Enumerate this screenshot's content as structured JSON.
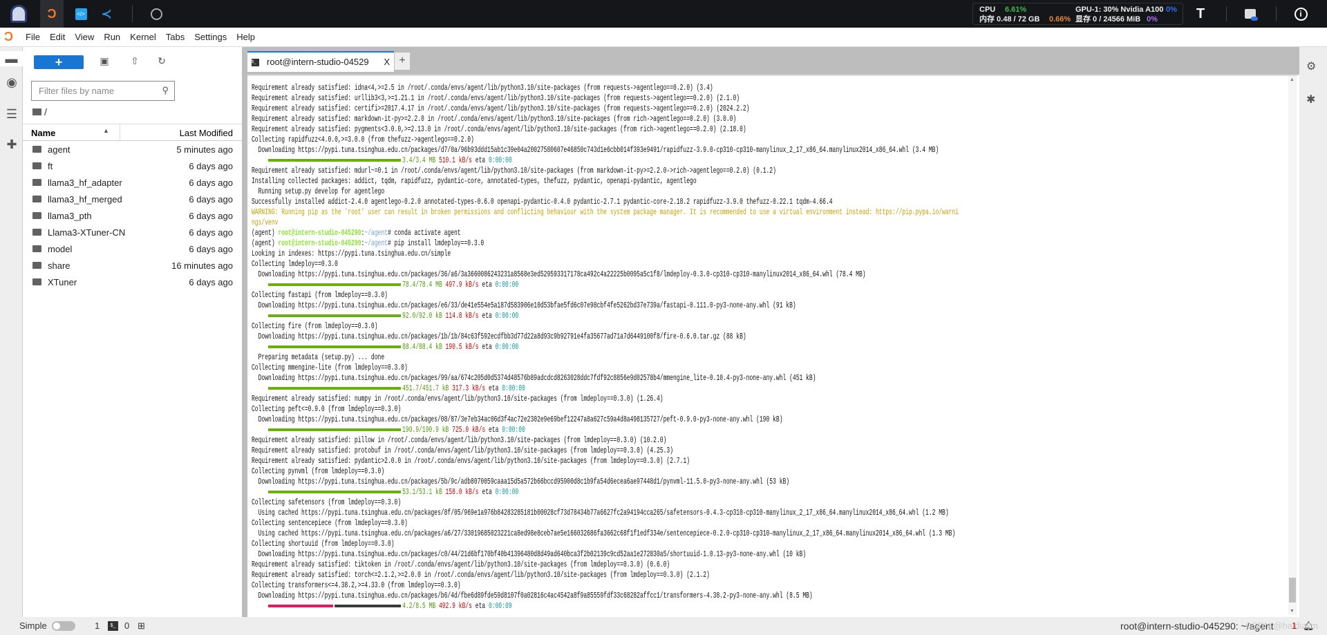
{
  "topbar": {
    "icons": [
      "avatar-logo",
      "jupyter-icon",
      "code-icon",
      "vscode-icon",
      "compass-icon"
    ],
    "cpu_label": "CPU",
    "cpu_value": "6.61%",
    "mem_label": "内存 0.48 / 72 GB",
    "mem_value": "0.66%",
    "gpu_label": "GPU-1: 30% Nvidia A100",
    "gpu_value": "0%",
    "vram_label": "显存 0 / 24566 MiB",
    "vram_value": "0%",
    "colors": {
      "cpu": "#3fb950",
      "mem": "#e3893b",
      "gpu": "#2f6feb",
      "vram": "#a371f7"
    }
  },
  "menu": [
    "File",
    "Edit",
    "View",
    "Run",
    "Kernel",
    "Tabs",
    "Settings",
    "Help"
  ],
  "files": {
    "filter_placeholder": "Filter files by name",
    "breadcrumb": "/",
    "col_name": "Name",
    "col_modified": "Last Modified",
    "rows": [
      {
        "name": "agent",
        "modified": "5 minutes ago"
      },
      {
        "name": "ft",
        "modified": "6 days ago"
      },
      {
        "name": "llama3_hf_adapter",
        "modified": "6 days ago"
      },
      {
        "name": "llama3_hf_merged",
        "modified": "6 days ago"
      },
      {
        "name": "llama3_pth",
        "modified": "6 days ago"
      },
      {
        "name": "Llama3-XTuner-CN",
        "modified": "6 days ago"
      },
      {
        "name": "model",
        "modified": "6 days ago"
      },
      {
        "name": "share",
        "modified": "16 minutes ago"
      },
      {
        "name": "XTuner",
        "modified": "6 days ago"
      }
    ]
  },
  "tab": {
    "title": "root@intern-studio-04529",
    "close": "X",
    "add": "+"
  },
  "terminal": {
    "lines": [
      {
        "t": "text",
        "s": "Requirement already satisfied: idna<4,>=2.5 in /root/.conda/envs/agent/lib/python3.10/site-packages (from requests->agentlego==0.2.0) (3.4)"
      },
      {
        "t": "text",
        "s": "Requirement already satisfied: urllib3<3,>=1.21.1 in /root/.conda/envs/agent/lib/python3.10/site-packages (from requests->agentlego==0.2.0) (2.1.0)"
      },
      {
        "t": "text",
        "s": "Requirement already satisfied: certifi>=2017.4.17 in /root/.conda/envs/agent/lib/python3.10/site-packages (from requests->agentlego==0.2.0) (2024.2.2)"
      },
      {
        "t": "text",
        "s": "Requirement already satisfied: markdown-it-py>=2.2.0 in /root/.conda/envs/agent/lib/python3.10/site-packages (from rich->agentlego==0.2.0) (3.0.0)"
      },
      {
        "t": "text",
        "s": "Requirement already satisfied: pygments<3.0.0,>=2.13.0 in /root/.conda/envs/agent/lib/python3.10/site-packages (from rich->agentlego==0.2.0) (2.18.0)"
      },
      {
        "t": "text",
        "s": "Collecting rapidfuzz<4.0.0,>=3.0.0 (from thefuzz->agentlego==0.2.0)"
      },
      {
        "t": "text",
        "s": "  Downloading https://pypi.tuna.tsinghua.edu.cn/packages/d7/0a/96b93ddd15ab1c39e04a20027580607e46850c743d1e6cbb014f393e9491/rapidfuzz-3.9.0-cp310-cp310-manylinux_2_17_x86_64.manylinux2014_x86_64.whl (3.4 MB)"
      },
      {
        "t": "progress",
        "fraction": 1.0,
        "size": "3.4/3.4 MB",
        "rate": "510.1 kB/s",
        "eta_label": "eta",
        "eta": "0:00:00"
      },
      {
        "t": "text",
        "s": "Requirement already satisfied: mdurl~=0.1 in /root/.conda/envs/agent/lib/python3.10/site-packages (from markdown-it-py>=2.2.0->rich->agentlego==0.2.0) (0.1.2)"
      },
      {
        "t": "text",
        "s": "Installing collected packages: addict, tqdm, rapidfuzz, pydantic-core, annotated-types, thefuzz, pydantic, openapi-pydantic, agentlego"
      },
      {
        "t": "text",
        "s": "  Running setup.py develop for agentlego"
      },
      {
        "t": "text",
        "s": "Successfully installed addict-2.4.0 agentlego-0.2.0 annotated-types-0.6.0 openapi-pydantic-0.4.0 pydantic-2.7.1 pydantic-core-2.18.2 rapidfuzz-3.9.0 thefuzz-0.22.1 tqdm-4.66.4"
      },
      {
        "t": "warn",
        "s": "WARNING: Running pip as the 'root' user can result in broken permissions and conflicting behaviour with the system package manager. It is recommended to use a virtual environment instead: https://pip.pypa.io/warni"
      },
      {
        "t": "warn",
        "s": "ngs/venv"
      },
      {
        "t": "prompt",
        "env": "(agent) ",
        "user": "root@intern-studio-045290",
        "sep": ":",
        "path": "~/agent",
        "cmd": "# conda activate agent"
      },
      {
        "t": "prompt",
        "env": "(agent) ",
        "user": "root@intern-studio-045290",
        "sep": ":",
        "path": "~/agent",
        "cmd": "# pip install lmdeploy==0.3.0"
      },
      {
        "t": "text",
        "s": "Looking in indexes: https://pypi.tuna.tsinghua.edu.cn/simple"
      },
      {
        "t": "text",
        "s": "Collecting lmdeploy==0.3.0"
      },
      {
        "t": "text",
        "s": "  Downloading https://pypi.tuna.tsinghua.edu.cn/packages/36/a6/3a3660086243231a8568e3ed529593317178ca492c4a22225b0095a5c1f8/lmdeploy-0.3.0-cp310-cp310-manylinux2014_x86_64.whl (78.4 MB)"
      },
      {
        "t": "progress",
        "fraction": 1.0,
        "size": "78.4/78.4 MB",
        "rate": "497.9 kB/s",
        "eta_label": "eta",
        "eta": "0:00:00"
      },
      {
        "t": "text",
        "s": "Collecting fastapi (from lmdeploy==0.3.0)"
      },
      {
        "t": "text",
        "s": "  Downloading https://pypi.tuna.tsinghua.edu.cn/packages/e6/33/de41e554e5a187d583906e10d53bfae5fd6c07e98cbf4fe5262bd37e739a/fastapi-0.111.0-py3-none-any.whl (91 kB)"
      },
      {
        "t": "progress",
        "fraction": 1.0,
        "size": "92.0/92.0 kB",
        "rate": "114.8 kB/s",
        "eta_label": "eta",
        "eta": "0:00:00"
      },
      {
        "t": "text",
        "s": "Collecting fire (from lmdeploy==0.3.0)"
      },
      {
        "t": "text",
        "s": "  Downloading https://pypi.tuna.tsinghua.edu.cn/packages/1b/1b/84c63f592ecdfbb3d77d22a8d93c9b92791e4fa35677ad71a7d6449100f8/fire-0.6.0.tar.gz (88 kB)"
      },
      {
        "t": "progress",
        "fraction": 1.0,
        "size": "88.4/88.4 kB",
        "rate": "190.5 kB/s",
        "eta_label": "eta",
        "eta": "0:00:00"
      },
      {
        "t": "text",
        "s": "  Preparing metadata (setup.py) ... done"
      },
      {
        "t": "text",
        "s": "Collecting mmengine-lite (from lmdeploy==0.3.0)"
      },
      {
        "t": "text",
        "s": "  Downloading https://pypi.tuna.tsinghua.edu.cn/packages/99/aa/674c205d0d5374d48576b89adcdcd8263028ddc7fdf92c8856e9d02578b4/mmengine_lite-0.10.4-py3-none-any.whl (451 kB)"
      },
      {
        "t": "progress",
        "fraction": 1.0,
        "size": "451.7/451.7 kB",
        "rate": "317.3 kB/s",
        "eta_label": "eta",
        "eta": "0:00:00"
      },
      {
        "t": "text",
        "s": "Requirement already satisfied: numpy in /root/.conda/envs/agent/lib/python3.10/site-packages (from lmdeploy==0.3.0) (1.26.4)"
      },
      {
        "t": "text",
        "s": "Collecting peft<=0.9.0 (from lmdeploy==0.3.0)"
      },
      {
        "t": "text",
        "s": "  Downloading https://pypi.tuna.tsinghua.edu.cn/packages/08/87/3e7eb34ac06d3f4ac72e2302e9e69bef12247a8a627c59a4d8a498135727/peft-0.9.0-py3-none-any.whl (190 kB)"
      },
      {
        "t": "progress",
        "fraction": 1.0,
        "size": "190.9/190.9 kB",
        "rate": "725.0 kB/s",
        "eta_label": "eta",
        "eta": "0:00:00"
      },
      {
        "t": "text",
        "s": "Requirement already satisfied: pillow in /root/.conda/envs/agent/lib/python3.10/site-packages (from lmdeploy==0.3.0) (10.2.0)"
      },
      {
        "t": "text",
        "s": "Requirement already satisfied: protobuf in /root/.conda/envs/agent/lib/python3.10/site-packages (from lmdeploy==0.3.0) (4.25.3)"
      },
      {
        "t": "text",
        "s": "Requirement already satisfied: pydantic>2.0.0 in /root/.conda/envs/agent/lib/python3.10/site-packages (from lmdeploy==0.3.0) (2.7.1)"
      },
      {
        "t": "text",
        "s": "Collecting pynvml (from lmdeploy==0.3.0)"
      },
      {
        "t": "text",
        "s": "  Downloading https://pypi.tuna.tsinghua.edu.cn/packages/5b/9c/adb8070059caaa15d5a572b66bccd95900d8c1b9fa54d6ecea6ae97448d1/pynvml-11.5.0-py3-none-any.whl (53 kB)"
      },
      {
        "t": "progress",
        "fraction": 1.0,
        "size": "53.1/53.1 kB",
        "rate": "158.0 kB/s",
        "eta_label": "eta",
        "eta": "0:00:00"
      },
      {
        "t": "text",
        "s": "Collecting safetensors (from lmdeploy==0.3.0)"
      },
      {
        "t": "text",
        "s": "  Using cached https://pypi.tuna.tsinghua.edu.cn/packages/8f/05/969e1a976b84283285181b00028cf73d78434b77a6627fc2a94194cca265/safetensors-0.4.3-cp310-cp310-manylinux_2_17_x86_64.manylinux2014_x86_64.whl (1.2 MB)"
      },
      {
        "t": "text",
        "s": "Collecting sentencepiece (from lmdeploy==0.3.0)"
      },
      {
        "t": "text",
        "s": "  Using cached https://pypi.tuna.tsinghua.edu.cn/packages/a6/27/33019685023221ca8ed98e8ceb7ae5e166032686fa3662c68f1f1edf334e/sentencepiece-0.2.0-cp310-cp310-manylinux_2_17_x86_64.manylinux2014_x86_64.whl (1.3 MB)"
      },
      {
        "t": "text",
        "s": "Collecting shortuuid (from lmdeploy==0.3.0)"
      },
      {
        "t": "text",
        "s": "  Downloading https://pypi.tuna.tsinghua.edu.cn/packages/c0/44/21d6bf170bf40b41396480d8d49ad640bca3f2b02139c9cd52aa1e272830a5/shortuuid-1.0.13-py3-none-any.whl (10 kB)"
      },
      {
        "t": "text",
        "s": "Requirement already satisfied: tiktoken in /root/.conda/envs/agent/lib/python3.10/site-packages (from lmdeploy==0.3.0) (0.6.0)"
      },
      {
        "t": "text",
        "s": "Requirement already satisfied: torch<=2.1.2,>=2.0.0 in /root/.conda/envs/agent/lib/python3.10/site-packages (from lmdeploy==0.3.0) (2.1.2)"
      },
      {
        "t": "text",
        "s": "Collecting transformers<=4.38.2,>=4.33.0 (from lmdeploy==0.3.0)"
      },
      {
        "t": "text",
        "s": "  Downloading https://pypi.tuna.tsinghua.edu.cn/packages/b6/4d/fbe6d89fde59d8107f0a02816c4ac4542a8f9a85559fdf33c68282affcc1/transformers-4.38.2-py3-none-any.whl (8.5 MB)"
      },
      {
        "t": "progress",
        "fraction": 0.49,
        "size": "4.2/8.5 MB",
        "rate": "492.9 kB/s",
        "eta_label": "eta",
        "eta": "0:00:09"
      }
    ],
    "colors": {
      "bar_done": "#6aaf0c",
      "bar_active": "#f2125a",
      "bar_rest": "#3a3a3a"
    }
  },
  "status": {
    "mode": "Simple",
    "terminals": "1",
    "kernels": "0",
    "right": "root@intern-studio-045290: ~/agent",
    "notifications": "1",
    "watermark": "CSDN @haidizym"
  }
}
